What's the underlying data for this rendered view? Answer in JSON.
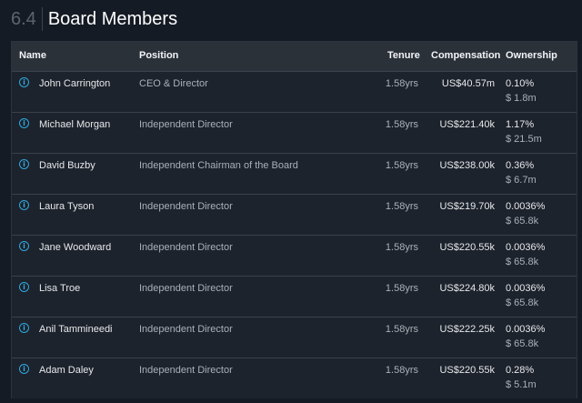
{
  "section": {
    "number": "6.4",
    "title": "Board Members"
  },
  "columns": {
    "name": "Name",
    "position": "Position",
    "tenure": "Tenure",
    "compensation": "Compensation",
    "ownership": "Ownership"
  },
  "members": [
    {
      "name": "John Carrington",
      "position": "CEO & Director",
      "tenure": "1.58yrs",
      "compensation": "US$40.57m",
      "ownership_pct": "0.10%",
      "ownership_value": "$ 1.8m"
    },
    {
      "name": "Michael Morgan",
      "position": "Independent Director",
      "tenure": "1.58yrs",
      "compensation": "US$221.40k",
      "ownership_pct": "1.17%",
      "ownership_value": "$ 21.5m"
    },
    {
      "name": "David Buzby",
      "position": "Independent Chairman of the Board",
      "tenure": "1.58yrs",
      "compensation": "US$238.00k",
      "ownership_pct": "0.36%",
      "ownership_value": "$ 6.7m"
    },
    {
      "name": "Laura Tyson",
      "position": "Independent Director",
      "tenure": "1.58yrs",
      "compensation": "US$219.70k",
      "ownership_pct": "0.0036%",
      "ownership_value": "$ 65.8k"
    },
    {
      "name": "Jane Woodward",
      "position": "Independent Director",
      "tenure": "1.58yrs",
      "compensation": "US$220.55k",
      "ownership_pct": "0.0036%",
      "ownership_value": "$ 65.8k"
    },
    {
      "name": "Lisa Troe",
      "position": "Independent Director",
      "tenure": "1.58yrs",
      "compensation": "US$224.80k",
      "ownership_pct": "0.0036%",
      "ownership_value": "$ 65.8k"
    },
    {
      "name": "Anil Tammineedi",
      "position": "Independent Director",
      "tenure": "1.58yrs",
      "compensation": "US$222.25k",
      "ownership_pct": "0.0036%",
      "ownership_value": "$ 65.8k"
    },
    {
      "name": "Adam Daley",
      "position": "Independent Director",
      "tenure": "1.58yrs",
      "compensation": "US$220.55k",
      "ownership_pct": "0.28%",
      "ownership_value": "$ 5.1m"
    }
  ],
  "colors": {
    "accent": "#2fa8e0",
    "background": "#151b24",
    "row": "#1d232c",
    "header": "#2b3139"
  }
}
